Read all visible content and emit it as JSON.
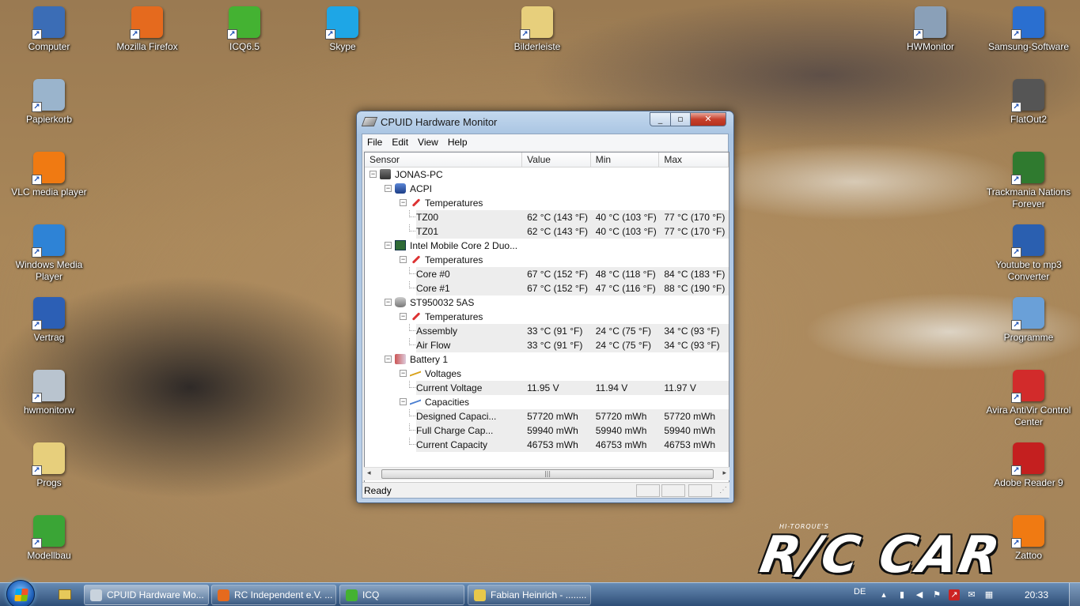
{
  "desktop": {
    "icons_left": [
      {
        "label": "Computer",
        "icon": "computer-icon",
        "color": "#3b6db6"
      },
      {
        "label": "Papierkorb",
        "icon": "recycle-bin-icon",
        "color": "#9ab4cc"
      },
      {
        "label": "VLC media player",
        "icon": "vlc-icon",
        "color": "#f07a12"
      },
      {
        "label": "Windows Media Player",
        "icon": "wmp-icon",
        "color": "#2e83d6"
      },
      {
        "label": "Vertrag",
        "icon": "word-doc-icon",
        "color": "#2c5fb5"
      },
      {
        "label": "hwmonitorw",
        "icon": "settings-file-icon",
        "color": "#b9c4cf"
      },
      {
        "label": "Progs",
        "icon": "folder-icon",
        "color": "#e7cf7c"
      },
      {
        "label": "Modellbau",
        "icon": "play-icon",
        "color": "#3aa536"
      }
    ],
    "icons_top": [
      {
        "label": "Mozilla Firefox",
        "icon": "firefox-icon",
        "color": "#e56a1e"
      },
      {
        "label": "ICQ6.5",
        "icon": "icq-icon",
        "color": "#44b232"
      },
      {
        "label": "Skype",
        "icon": "skype-icon",
        "color": "#1ea6e6"
      },
      {
        "label": "Bilderleiste",
        "icon": "folder-icon",
        "color": "#e7cf7c"
      },
      {
        "label": "HWMonitor",
        "icon": "hwmonitor-icon",
        "color": "#8aa0b8"
      }
    ],
    "icons_right": [
      {
        "label": "Samsung-Software",
        "icon": "info-icon",
        "color": "#2a6fd0"
      },
      {
        "label": "FlatOut2",
        "icon": "flatout-icon",
        "color": "#555555"
      },
      {
        "label": "Trackmania Nations Forever",
        "icon": "trackmania-icon",
        "color": "#2f7a2f"
      },
      {
        "label": "Youtube to mp3 Converter",
        "icon": "fs-icon",
        "color": "#2a5fb0"
      },
      {
        "label": "Programme",
        "icon": "programs-icon",
        "color": "#6aa0d8"
      },
      {
        "label": "Avira AntiVir Control Center",
        "icon": "avira-icon",
        "color": "#d22b2b"
      },
      {
        "label": "Adobe Reader 9",
        "icon": "adobe-icon",
        "color": "#c41f1f"
      },
      {
        "label": "Zattoo",
        "icon": "zattoo-icon",
        "color": "#f07a12"
      }
    ],
    "wallpaper_logo": "R/C CAR",
    "wallpaper_tag": "HI-TORQUE'S"
  },
  "window": {
    "title": "CPUID Hardware Monitor",
    "menu": [
      "File",
      "Edit",
      "View",
      "Help"
    ],
    "columns": [
      "Sensor",
      "Value",
      "Min",
      "Max"
    ],
    "tree": [
      {
        "level": 0,
        "label": "JONAS-PC",
        "icon": "computer-icon",
        "kind": "node"
      },
      {
        "level": 1,
        "label": "ACPI",
        "icon": "acpi-icon",
        "kind": "node"
      },
      {
        "level": 2,
        "label": "Temperatures",
        "icon": "thermometer-icon",
        "kind": "group"
      },
      {
        "level": 3,
        "label": "TZ00",
        "value": "62 °C  (143 °F)",
        "min": "40 °C  (103 °F)",
        "max": "77 °C  (170 °F)",
        "kind": "leaf"
      },
      {
        "level": 3,
        "label": "TZ01",
        "value": "62 °C  (143 °F)",
        "min": "40 °C  (103 °F)",
        "max": "77 °C  (170 °F)",
        "kind": "leaf"
      },
      {
        "level": 1,
        "label": "Intel Mobile Core 2 Duo...",
        "icon": "cpu-icon",
        "kind": "node"
      },
      {
        "level": 2,
        "label": "Temperatures",
        "icon": "thermometer-icon",
        "kind": "group"
      },
      {
        "level": 3,
        "label": "Core #0",
        "value": "67 °C  (152 °F)",
        "min": "48 °C  (118 °F)",
        "max": "84 °C  (183 °F)",
        "kind": "leaf"
      },
      {
        "level": 3,
        "label": "Core #1",
        "value": "67 °C  (152 °F)",
        "min": "47 °C  (116 °F)",
        "max": "88 °C  (190 °F)",
        "kind": "leaf"
      },
      {
        "level": 1,
        "label": "ST950032 5AS",
        "icon": "hard-disk-icon",
        "kind": "node"
      },
      {
        "level": 2,
        "label": "Temperatures",
        "icon": "thermometer-icon",
        "kind": "group"
      },
      {
        "level": 3,
        "label": "Assembly",
        "value": "33 °C  (91 °F)",
        "min": "24 °C  (75 °F)",
        "max": "34 °C  (93 °F)",
        "kind": "leaf"
      },
      {
        "level": 3,
        "label": "Air Flow",
        "value": "33 °C  (91 °F)",
        "min": "24 °C  (75 °F)",
        "max": "34 °C  (93 °F)",
        "kind": "leaf"
      },
      {
        "level": 1,
        "label": "Battery 1",
        "icon": "battery-icon",
        "kind": "node"
      },
      {
        "level": 2,
        "label": "Voltages",
        "icon": "voltage-icon",
        "kind": "group"
      },
      {
        "level": 3,
        "label": "Current Voltage",
        "value": "11.95 V",
        "min": "11.94 V",
        "max": "11.97 V",
        "kind": "leaf"
      },
      {
        "level": 2,
        "label": "Capacities",
        "icon": "capacity-icon",
        "kind": "group"
      },
      {
        "level": 3,
        "label": "Designed Capaci...",
        "value": "57720 mWh",
        "min": "57720 mWh",
        "max": "57720 mWh",
        "kind": "leaf"
      },
      {
        "level": 3,
        "label": "Full Charge Cap...",
        "value": "59940 mWh",
        "min": "59940 mWh",
        "max": "59940 mWh",
        "kind": "leaf"
      },
      {
        "level": 3,
        "label": "Current Capacity",
        "value": "46753 mWh",
        "min": "46753 mWh",
        "max": "46753 mWh",
        "kind": "leaf"
      }
    ],
    "status": "Ready"
  },
  "taskbar": {
    "items": [
      {
        "label": "CPUID Hardware Mo...",
        "icon": "hwmonitor-icon",
        "color": "#c9d3dd",
        "active": true
      },
      {
        "label": "RC Independent e.V. ...",
        "icon": "firefox-icon",
        "color": "#e56a1e",
        "active": false
      },
      {
        "label": "ICQ",
        "icon": "icq-icon",
        "color": "#44b232",
        "active": false
      },
      {
        "label": "Fabian Heinrich - ........",
        "icon": "chat-icon",
        "color": "#e8c84a",
        "active": false
      }
    ],
    "language": "DE",
    "clock": "20:33"
  }
}
